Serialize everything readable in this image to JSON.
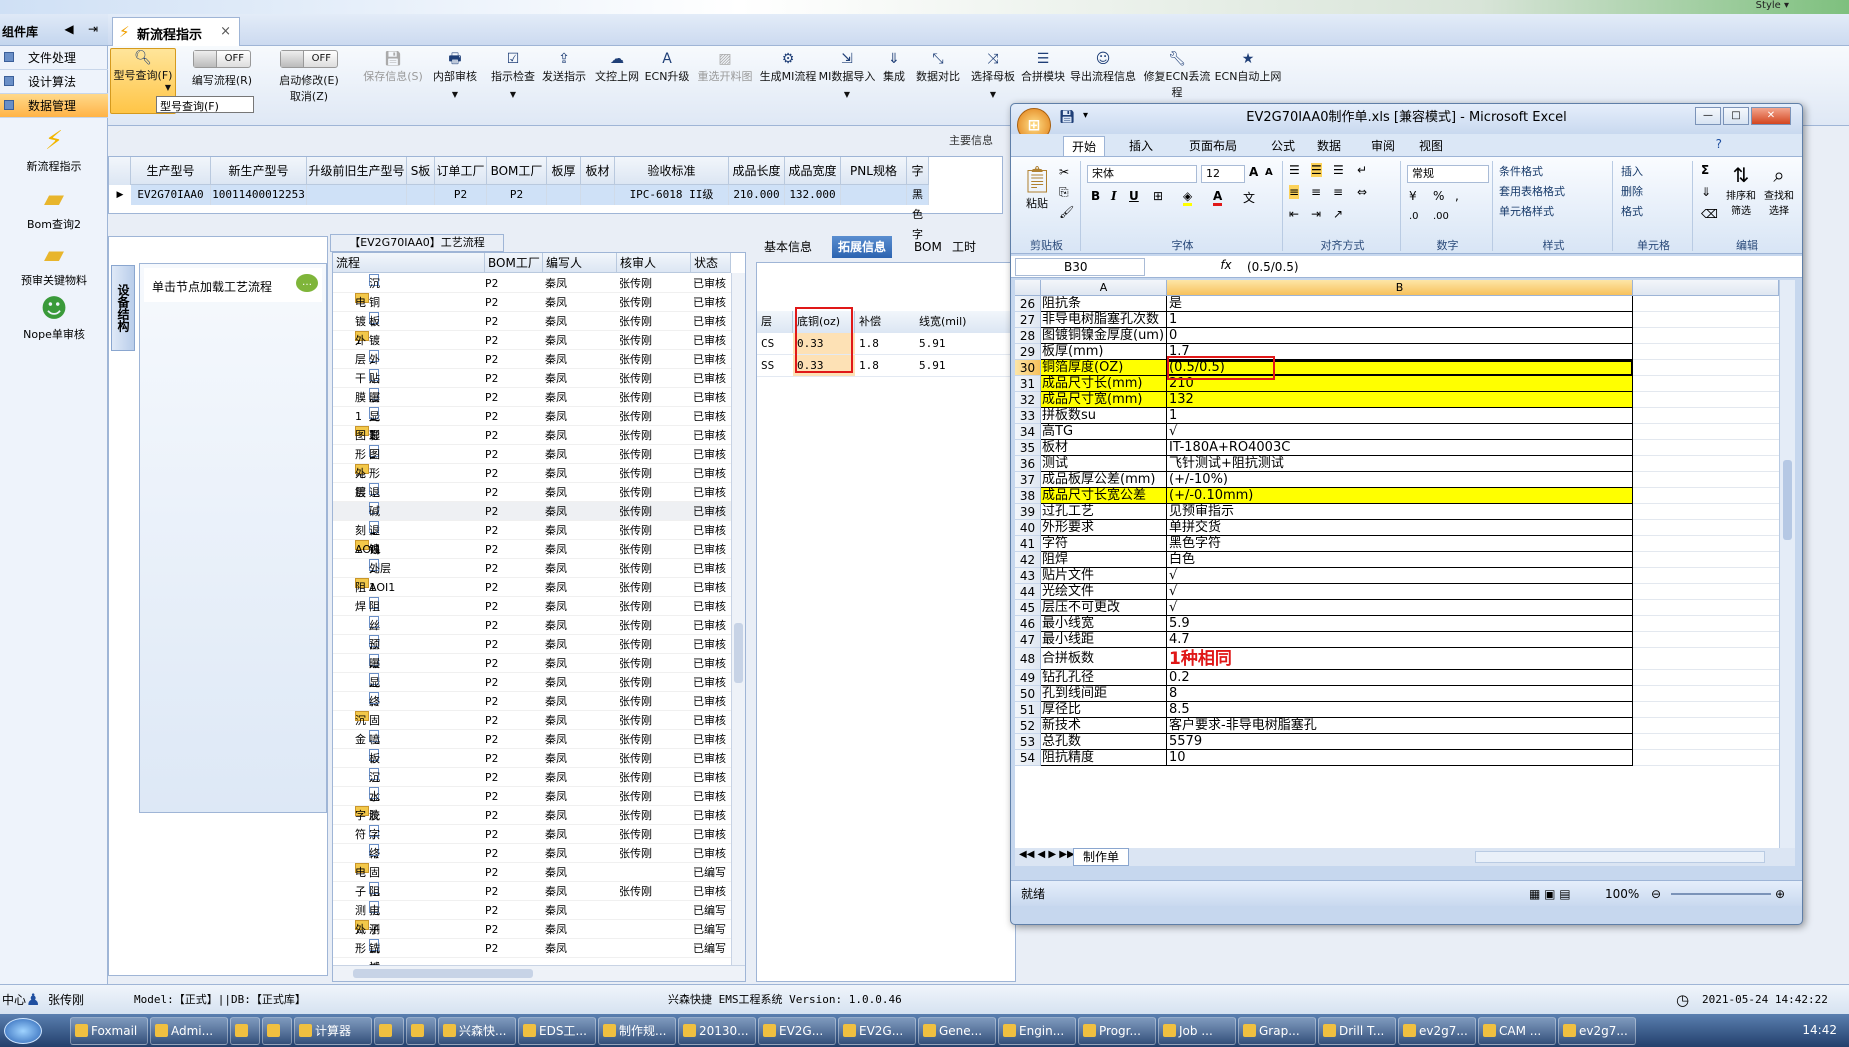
{
  "topbar": {
    "style_label": "Style ▾"
  },
  "sidebar": {
    "title": "组件库",
    "menus": [
      {
        "label": "文件处理",
        "active": false
      },
      {
        "label": "设计算法",
        "active": false
      },
      {
        "label": "数据管理",
        "active": true
      }
    ],
    "big_items": [
      {
        "label": "新流程指示",
        "icon": "lightning-icon"
      },
      {
        "label": "Bom查询2",
        "icon": "folder-icon"
      },
      {
        "label": "预审关键物料",
        "icon": "folder-icon"
      },
      {
        "label": "Nope单审核",
        "icon": "user-icon"
      }
    ]
  },
  "tabs": [
    {
      "label": "新流程指示",
      "close": "×"
    }
  ],
  "ribbon": {
    "query": "型号查询(F)",
    "toggle_off": "OFF",
    "toggle1_label": "编写流程(R)",
    "toggle2_label": "启动修改(E)",
    "toggle2_sub": "取消(Z)",
    "buttons": [
      {
        "label": "保存信息(S)",
        "disabled": true
      },
      {
        "label": "内部审核",
        "disabled": false
      },
      {
        "label": "指示检查",
        "disabled": false
      },
      {
        "label": "发送指示",
        "disabled": false
      },
      {
        "label": "文控上网",
        "disabled": false
      },
      {
        "label": "ECN升级",
        "disabled": false
      },
      {
        "label": "重选开料图",
        "disabled": true
      },
      {
        "label": "生成MI流程",
        "disabled": false
      },
      {
        "label": "MI数据导入",
        "disabled": false
      },
      {
        "label": "集成",
        "disabled": false
      },
      {
        "label": "数据对比",
        "disabled": false
      },
      {
        "label": "选择母板",
        "disabled": false
      },
      {
        "label": "合拼模块",
        "disabled": false
      },
      {
        "label": "导出流程信息",
        "disabled": false
      },
      {
        "label": "修复ECN丢流程",
        "disabled": false
      },
      {
        "label": "ECN自动上网",
        "disabled": false
      }
    ],
    "tooltip": "型号查询(F)",
    "main_info": "主要信息"
  },
  "grid": {
    "headers": [
      "生产型号",
      "新生产型号",
      "升级前旧生产型号",
      "S板",
      "订单工厂",
      "BOM工厂",
      "板厚",
      "板材",
      "验收标准",
      "成品长度",
      "成品宽度",
      "PNL规格",
      "字"
    ],
    "row": [
      "EV2G70IAA0",
      "10011400012253",
      "",
      "",
      "P2",
      "P2",
      "",
      "",
      "IPC-6018 II级",
      "210.000",
      "132.000",
      "",
      "黑色字"
    ]
  },
  "left_panel": {
    "vtab": "设备结构",
    "hint": "单击节点加载工艺流程"
  },
  "tree": {
    "title": "【EV2G70IAA0】工艺流程",
    "headers": [
      "流程",
      "BOM工厂",
      "编写人",
      "核审人",
      "状态"
    ],
    "rows": [
      {
        "name": "沉铜1",
        "lvl": 2,
        "f": "P2",
        "w": "秦凤",
        "r": "张传刚",
        "s": "已审核"
      },
      {
        "name": "电镀1",
        "lvl": 1,
        "f": "P2",
        "w": "秦凤",
        "r": "张传刚",
        "s": "已审核"
      },
      {
        "name": "板镀1",
        "lvl": 2,
        "f": "P2",
        "w": "秦凤",
        "r": "张传刚",
        "s": "已审核"
      },
      {
        "name": "外层干膜1",
        "lvl": 1,
        "f": "P2",
        "w": "秦凤",
        "r": "张传刚",
        "s": "已审核"
      },
      {
        "name": "外层前处理1",
        "lvl": 2,
        "f": "P2",
        "w": "秦凤",
        "r": "张传刚",
        "s": "已审核"
      },
      {
        "name": "贴膜1",
        "lvl": 2,
        "f": "P2",
        "w": "秦凤",
        "r": "张传刚",
        "s": "已审核"
      },
      {
        "name": "曝光1",
        "lvl": 2,
        "f": "P2",
        "w": "秦凤",
        "r": "张传刚",
        "s": "已审核"
      },
      {
        "name": "显影1",
        "lvl": 2,
        "f": "P2",
        "w": "秦凤",
        "r": "张传刚",
        "s": "已审核"
      },
      {
        "name": "图形电镀1",
        "lvl": 1,
        "f": "P2",
        "w": "秦凤",
        "r": "张传刚",
        "s": "已审核"
      },
      {
        "name": "图形电镀1",
        "lvl": 2,
        "f": "P2",
        "w": "秦凤",
        "r": "张传刚",
        "s": "已审核"
      },
      {
        "name": "外层蚀刻1",
        "lvl": 1,
        "f": "P2",
        "w": "秦凤",
        "r": "张传刚",
        "s": "已审核"
      },
      {
        "name": "退膜1",
        "lvl": 2,
        "f": "P2",
        "w": "秦凤",
        "r": "张传刚",
        "s": "已审核"
      },
      {
        "name": "碱性蚀刻1",
        "lvl": 2,
        "f": "P2",
        "w": "秦凤",
        "r": "张传刚",
        "s": "已审核"
      },
      {
        "name": "退锡1",
        "lvl": 2,
        "f": "P2",
        "w": "秦凤",
        "r": "张传刚",
        "s": "已审核"
      },
      {
        "name": "AOI1",
        "lvl": 1,
        "f": "P2",
        "w": "秦凤",
        "r": "张传刚",
        "s": "已审核"
      },
      {
        "name": "外层AOI1",
        "lvl": 2,
        "f": "P2",
        "w": "秦凤",
        "r": "张传刚",
        "s": "已审核"
      },
      {
        "name": "阻焊",
        "lvl": 1,
        "f": "P2",
        "w": "秦凤",
        "r": "张传刚",
        "s": "已审核"
      },
      {
        "name": "阻焊前处理",
        "lvl": 2,
        "f": "P2",
        "w": "秦凤",
        "r": "张传刚",
        "s": "已审核"
      },
      {
        "name": "丝印",
        "lvl": 2,
        "f": "P2",
        "w": "秦凤",
        "r": "张传刚",
        "s": "已审核"
      },
      {
        "name": "预烘",
        "lvl": 2,
        "f": "P2",
        "w": "秦凤",
        "r": "张传刚",
        "s": "已审核"
      },
      {
        "name": "曝光",
        "lvl": 2,
        "f": "P2",
        "w": "秦凤",
        "r": "张传刚",
        "s": "已审核"
      },
      {
        "name": "显影",
        "lvl": 2,
        "f": "P2",
        "w": "秦凤",
        "r": "张传刚",
        "s": "已审核"
      },
      {
        "name": "终固化",
        "lvl": 2,
        "f": "P2",
        "w": "秦凤",
        "r": "张传刚",
        "s": "已审核"
      },
      {
        "name": "沉金",
        "lvl": 1,
        "f": "P2",
        "w": "秦凤",
        "r": "张传刚",
        "s": "已审核"
      },
      {
        "name": "喷砂",
        "lvl": 2,
        "f": "P2",
        "w": "秦凤",
        "r": "张传刚",
        "s": "已审核"
      },
      {
        "name": "板边包胶",
        "lvl": 2,
        "f": "P2",
        "w": "秦凤",
        "r": "张传刚",
        "s": "已审核"
      },
      {
        "name": "沉金",
        "lvl": 2,
        "f": "P2",
        "w": "秦凤",
        "r": "张传刚",
        "s": "已审核"
      },
      {
        "name": "水洗烘干",
        "lvl": 2,
        "f": "P2",
        "w": "秦凤",
        "r": "张传刚",
        "s": "已审核"
      },
      {
        "name": "字符",
        "lvl": 1,
        "f": "P2",
        "w": "秦凤",
        "r": "张传刚",
        "s": "已审核"
      },
      {
        "name": "字符",
        "lvl": 2,
        "f": "P2",
        "w": "秦凤",
        "r": "张传刚",
        "s": "已审核"
      },
      {
        "name": "终固化",
        "lvl": 2,
        "f": "P2",
        "w": "秦凤",
        "r": "张传刚",
        "s": "已审核"
      },
      {
        "name": "电子测试",
        "lvl": 1,
        "f": "P2",
        "w": "秦凤",
        "r": "",
        "s": "已编写"
      },
      {
        "name": "阻抗测试",
        "lvl": 2,
        "f": "P2",
        "w": "秦凤",
        "r": "张传刚",
        "s": "已审核"
      },
      {
        "name": "电子测试",
        "lvl": 2,
        "f": "P2",
        "w": "秦凤",
        "r": "",
        "s": "已编写"
      },
      {
        "name": "外形",
        "lvl": 1,
        "f": "P2",
        "w": "秦凤",
        "r": "",
        "s": "已编写"
      },
      {
        "name": "铣板",
        "lvl": 2,
        "f": "P2",
        "w": "秦凤",
        "r": "",
        "s": "已编写"
      }
    ]
  },
  "info": {
    "tabs": [
      {
        "label": "基本信息",
        "active": false
      },
      {
        "label": "拓展信息",
        "active": true
      },
      {
        "label": "BOM",
        "active": false
      },
      {
        "label": "工时",
        "active": false
      }
    ],
    "headers": [
      "层",
      "底铜(oz)",
      "补偿",
      "线宽(mil)"
    ],
    "rows": [
      [
        "CS",
        "0.33",
        "1.8",
        "5.91"
      ],
      [
        "SS",
        "0.33",
        "1.8",
        "5.91"
      ]
    ]
  },
  "excel": {
    "title": "EV2G70IAA0制作单.xls  [兼容模式] - Microsoft Excel",
    "menus": [
      {
        "label": "开始",
        "active": true
      },
      {
        "label": "插入",
        "active": false
      },
      {
        "label": "页面布局",
        "active": false
      },
      {
        "label": "公式",
        "active": false
      },
      {
        "label": "数据",
        "active": false
      },
      {
        "label": "审阅",
        "active": false
      },
      {
        "label": "视图",
        "active": false
      }
    ],
    "font": "宋体",
    "size": "12",
    "number_format": "常规",
    "groups": {
      "clipboard": "剪贴板",
      "font": "字体",
      "align": "对齐方式",
      "number": "数字",
      "style": "样式",
      "cells": "单元格",
      "edit": "编辑"
    },
    "paste": "粘贴",
    "style_btns": [
      "条件格式",
      "套用表格格式",
      "单元格样式"
    ],
    "cell_btns": [
      "插入",
      "删除",
      "格式"
    ],
    "edit_btns": [
      "排序和筛选",
      "查找和选择"
    ],
    "namebox": "B30",
    "formula": "(0.5/0.5)",
    "cols": [
      "A",
      "B"
    ],
    "rows": [
      {
        "n": "26",
        "a": "阻抗条",
        "b": "是",
        "y": false
      },
      {
        "n": "27",
        "a": "非导电树脂塞孔次数",
        "b": "1",
        "y": false
      },
      {
        "n": "28",
        "a": "图镀铜镍金厚度(um)",
        "b": "0",
        "y": false
      },
      {
        "n": "29",
        "a": "板厚(mm)",
        "b": "1.7",
        "y": false
      },
      {
        "n": "30",
        "a": "铜箔厚度(OZ)",
        "b": "(0.5/0.5)",
        "y": true,
        "sel": true
      },
      {
        "n": "31",
        "a": "成品尺寸长(mm)",
        "b": "210",
        "y": true
      },
      {
        "n": "32",
        "a": "成品尺寸宽(mm)",
        "b": "132",
        "y": true
      },
      {
        "n": "33",
        "a": "拼板数su",
        "b": "1",
        "y": false
      },
      {
        "n": "34",
        "a": "高TG",
        "b": "√",
        "y": false
      },
      {
        "n": "35",
        "a": "板材",
        "b": "IT-180A+RO4003C",
        "y": false
      },
      {
        "n": "36",
        "a": "测试",
        "b": "飞针测试+阻抗测试",
        "y": false
      },
      {
        "n": "37",
        "a": "成品板厚公差(mm)",
        "b": "(+/-10%)",
        "y": false
      },
      {
        "n": "38",
        "a": "成品尺寸长宽公差",
        "b": "(+/-0.10mm)",
        "y": true
      },
      {
        "n": "39",
        "a": "过孔工艺",
        "b": "见预审指示",
        "y": false
      },
      {
        "n": "40",
        "a": "外形要求",
        "b": "单拼交货",
        "y": false
      },
      {
        "n": "41",
        "a": "字符",
        "b": "黑色字符",
        "y": false
      },
      {
        "n": "42",
        "a": "阻焊",
        "b": "白色",
        "y": false
      },
      {
        "n": "43",
        "a": "贴片文件",
        "b": "√",
        "y": false
      },
      {
        "n": "44",
        "a": "光绘文件",
        "b": "√",
        "y": false
      },
      {
        "n": "45",
        "a": "层压不可更改",
        "b": "√",
        "y": false
      },
      {
        "n": "46",
        "a": "最小线宽",
        "b": "5.9",
        "y": false
      },
      {
        "n": "47",
        "a": "最小线距",
        "b": "4.7",
        "y": false
      },
      {
        "n": "48",
        "a": "合拼板数",
        "b": "1种相同",
        "y": false,
        "big": true
      },
      {
        "n": "49",
        "a": "钻孔孔径",
        "b": "0.2",
        "y": false
      },
      {
        "n": "50",
        "a": "孔到线间距",
        "b": "8",
        "y": false
      },
      {
        "n": "51",
        "a": "厚径比",
        "b": "8.5",
        "y": false
      },
      {
        "n": "52",
        "a": "新技术",
        "b": "客户要求-非导电树脂塞孔",
        "y": false
      },
      {
        "n": "53",
        "a": "总孔数",
        "b": "5579",
        "y": false
      },
      {
        "n": "54",
        "a": "阻抗精度",
        "b": "10",
        "y": false
      }
    ],
    "sheet_tab": "制作单",
    "status": "就绪",
    "zoom": "100%"
  },
  "status": {
    "left": "中心",
    "user": "张传刚",
    "model": "Model:【正式】||DB:【正式库】",
    "system": "兴森快捷  EMS工程系统  Version: 1.0.0.46",
    "datetime": "2021-05-24 14:42:22"
  },
  "taskbar": {
    "items": [
      "Foxmail",
      "Admi...",
      "",
      "",
      "计算器",
      "",
      "",
      "兴森快...",
      "EDS工...",
      "制作规...",
      "20130...",
      "EV2G...",
      "EV2G...",
      "Gene...",
      "Engin...",
      "Progr...",
      "Job ...",
      "Grap...",
      "Drill T...",
      "ev2g7...",
      "CAM ...",
      "ev2g7..."
    ],
    "time": "14:42"
  }
}
